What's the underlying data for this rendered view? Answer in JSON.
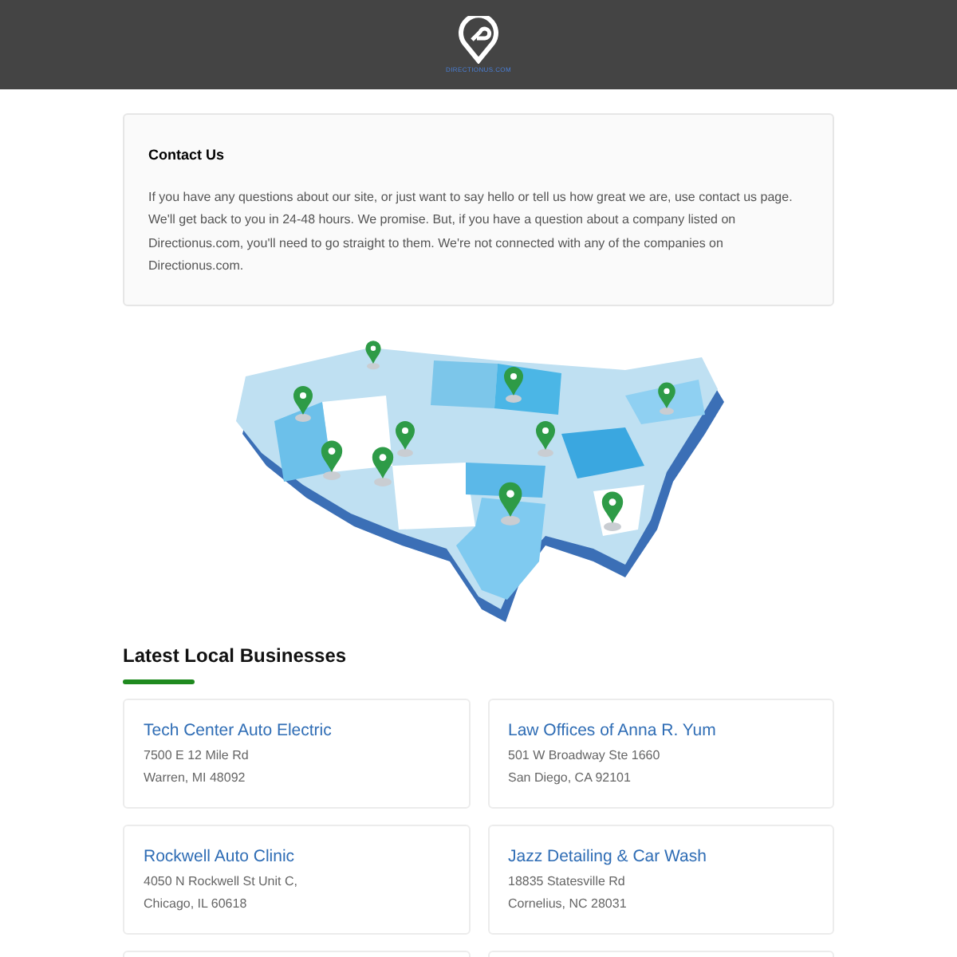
{
  "header": {
    "logo_text": "DIRECTIONUS.COM"
  },
  "contact": {
    "title": "Contact Us",
    "body": "If you have any questions about our site, or just want to say hello or tell us how great we are, use contact us page. We'll get back to you in 24-48 hours. We promise. But, if you have a question about a company listed on Directionus.com, you'll need to go straight to them. We're not connected with any of the companies on Directionus.com."
  },
  "section_title": "Latest Local Businesses",
  "businesses": [
    {
      "name": "Tech Center Auto Electric",
      "address": "7500 E 12 Mile Rd",
      "city": "Warren, MI 48092"
    },
    {
      "name": "Law Offices of Anna R. Yum",
      "address": "501 W Broadway Ste 1660",
      "city": "San Diego, CA 92101"
    },
    {
      "name": "Rockwell Auto Clinic",
      "address": "4050 N Rockwell St Unit C,",
      "city": "Chicago, IL 60618"
    },
    {
      "name": "Jazz Detailing & Car Wash",
      "address": "18835 Statesville Rd",
      "city": "Cornelius, NC 28031"
    }
  ]
}
